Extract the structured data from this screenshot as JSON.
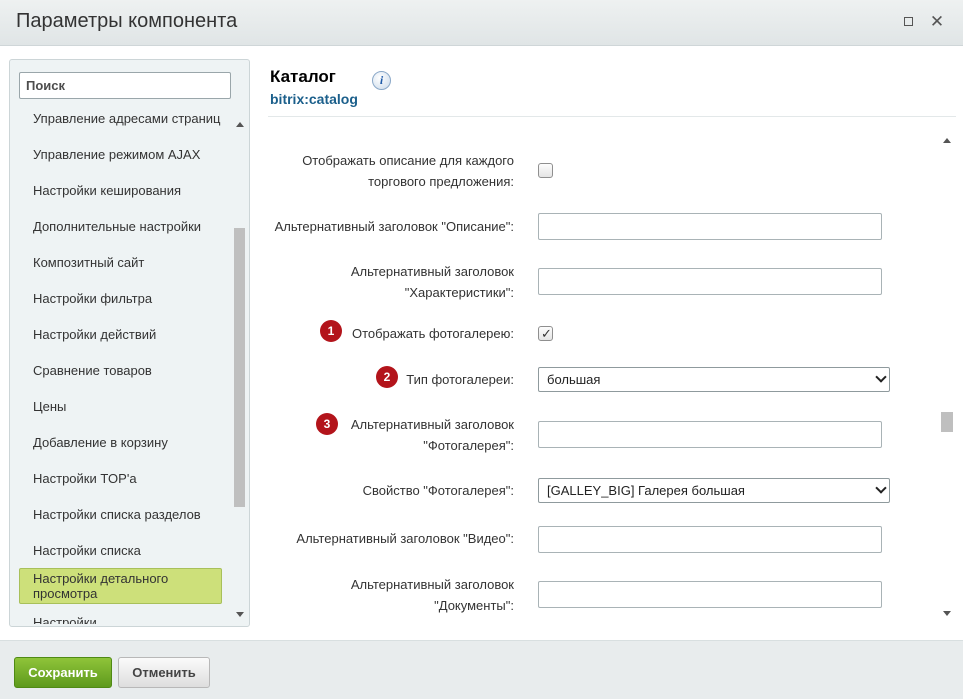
{
  "window": {
    "title": "Параметры компонента"
  },
  "sidebar": {
    "search_placeholder": "Поиск",
    "items": [
      {
        "label": "Управление адресами страниц"
      },
      {
        "label": "Управление режимом AJAX"
      },
      {
        "label": "Настройки кеширования"
      },
      {
        "label": "Дополнительные настройки"
      },
      {
        "label": "Композитный сайт"
      },
      {
        "label": "Настройки фильтра"
      },
      {
        "label": "Настройки действий"
      },
      {
        "label": "Сравнение товаров"
      },
      {
        "label": "Цены"
      },
      {
        "label": "Добавление в корзину"
      },
      {
        "label": "Настройки TOP'а"
      },
      {
        "label": "Настройки списка разделов"
      },
      {
        "label": "Настройки списка"
      },
      {
        "label": "Настройки детального просмотра",
        "active": true
      },
      {
        "label": "Настройки"
      }
    ]
  },
  "header": {
    "title": "Каталог",
    "subtitle": "bitrix:catalog",
    "info_icon": "i"
  },
  "form": {
    "show_offer_description": {
      "label_line1": "Отображать описание для каждого",
      "label_line2": "торгового предложения:",
      "checked": false
    },
    "alt_title_description": {
      "label": "Альтернативный заголовок \"Описание\":",
      "value": ""
    },
    "alt_title_properties": {
      "label_line1": "Альтернативный заголовок",
      "label_line2": "\"Характеристики\":",
      "value": ""
    },
    "show_gallery": {
      "label": "Отображать фотогалерею:",
      "checked": true,
      "badge": "1",
      "tick": "✓"
    },
    "gallery_type": {
      "label": "Тип фотогалереи:",
      "value": "большая",
      "badge": "2"
    },
    "alt_title_gallery": {
      "label_line1": "Альтернативный заголовок",
      "label_line2": "\"Фотогалерея\":",
      "value": "",
      "badge": "3"
    },
    "gallery_property": {
      "label": "Свойство \"Фотогалерея\":",
      "value": "[GALLEY_BIG] Галерея большая"
    },
    "alt_title_video": {
      "label": "Альтернативный заголовок \"Видео\":",
      "value": ""
    },
    "alt_title_docs": {
      "label_line1": "Альтернативный заголовок",
      "label_line2": "\"Документы\":",
      "value": ""
    }
  },
  "footer": {
    "save_label": "Сохранить",
    "cancel_label": "Отменить"
  },
  "colors": {
    "accent_green": "#6aa823",
    "badge_red": "#b3141b",
    "link_blue": "#1b5f8b",
    "active_item": "#cde07a"
  }
}
